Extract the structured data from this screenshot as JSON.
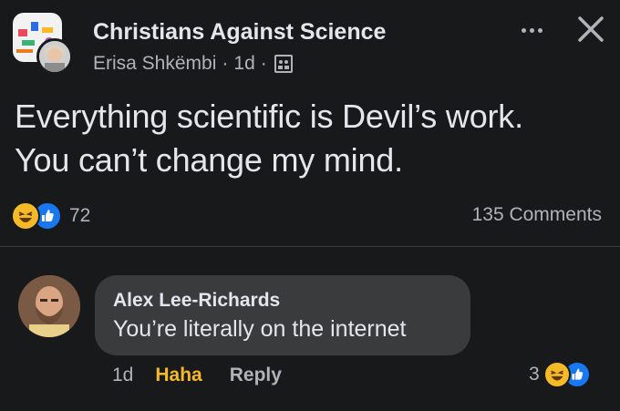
{
  "post": {
    "group_name": "Christians Against Science",
    "author": "Erisa Shkëmbi",
    "separator": "·",
    "time": "1d",
    "text": "Everything scientific is Devil’s work.\nYou can’t change my mind.",
    "reaction_count": "72",
    "comments_count": "135 Comments",
    "reactions": [
      "haha-icon",
      "like-icon"
    ]
  },
  "comment": {
    "author": "Alex Lee-Richards",
    "text": "You’re literally on the internet",
    "time": "1d",
    "haha_label": "Haha",
    "reply_label": "Reply",
    "reaction_count": "3",
    "reactions": [
      "haha-icon",
      "like-icon"
    ]
  },
  "colors": {
    "background": "#18191a",
    "bubble": "#3a3b3c",
    "primary_text": "#e4e6eb",
    "secondary_text": "#b0b3b8",
    "haha_yellow": "#f7b928",
    "like_blue": "#1877f2"
  }
}
